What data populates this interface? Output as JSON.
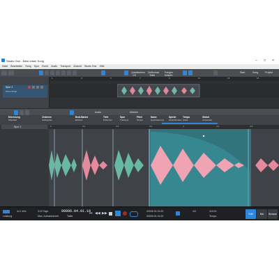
{
  "window": {
    "title": "Studio One - Mein erster Song"
  },
  "menu": [
    "Datei",
    "Bearbeiten",
    "Song",
    "Spur",
    "Event",
    "Audio",
    "Transport",
    "Ansicht",
    "Studio One",
    "Hilfe"
  ],
  "toolbar": {
    "quantize_label": "Quantisieren",
    "quantize_value": "1/4",
    "timebase_label": "Zeitformat",
    "timebase_value": "Takte",
    "snap_label": "Fangen",
    "snap_value": "Adaptiv",
    "start": "Start",
    "song": "Song",
    "project": "Projekt"
  },
  "overview": {
    "track_name": "Spur 1",
    "track_sub": "Spurenfolge",
    "ruler": [
      "1",
      "3",
      "5",
      "7",
      "9",
      "11",
      "13",
      "15"
    ]
  },
  "midbar": {
    "zoom": "Audio",
    "section": "Ableton"
  },
  "properties": [
    {
      "title": "Erkennung",
      "sub": "Standard"
    },
    {
      "title": "Zeichnen",
      "sub": "Audiopulse"
    },
    {
      "title": "Beat-Marker",
      "sub": "Ein/Aus"
    },
    {
      "title": "Tiefe",
      "sub": "Entfernen"
    },
    {
      "title": "Spur",
      "sub": "Transient"
    },
    {
      "title": "Pitch",
      "sub": "Tempo"
    },
    {
      "title": "Name",
      "sub": "Quantisierung"
    },
    {
      "title": "Spieler",
      "sub": "Stretchmodus"
    },
    {
      "title": "Tempo",
      "sub": "Audio"
    },
    {
      "title": "Global",
      "sub": "Anwenden"
    }
  ],
  "editor": {
    "track_name": "Spur 1",
    "ruler": [
      "3",
      "3.2",
      "3.3",
      "3.4",
      "4",
      "4.2",
      "4.3"
    ]
  },
  "transport": {
    "cpu_label": "Leistung",
    "samplerate": "44,1 kHz",
    "length": "3:20 Tage",
    "sub": "Max. Aufnahmezeit",
    "position": "00006.04.01.10",
    "position_sub": "Takte",
    "loop_start": "00005.01.01.00",
    "loop_end": "00009.01.01.00",
    "signature": "4/4",
    "tempo": "115.00",
    "tempo_label": "Tempo",
    "modes": [
      "Edit",
      "Mix",
      "Browse"
    ]
  },
  "colors": {
    "accent": "#2f86d8",
    "clip_teal": "#5fae9c",
    "clip_pink": "#e07f93",
    "selected_bg": "#2f7c86"
  }
}
